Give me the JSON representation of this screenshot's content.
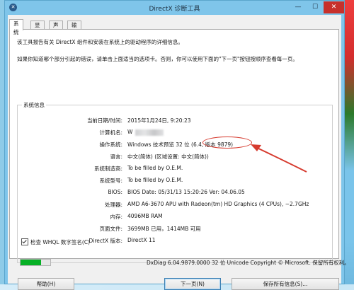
{
  "window": {
    "title": "DirectX 诊断工具",
    "icon_glyph": "✕"
  },
  "tabs": [
    "系统",
    "显示",
    "声音",
    "输入"
  ],
  "intro": {
    "line1": "该工具报告有关 DirectX 组件和安装在系统上的驱动程序的详细信息。",
    "line2": "如果你知道哪个部分引起的错误，请单击上面适当的选项卡。否则，你可以使用下面的\"下一页\"按钮按顺序查看每一页。"
  },
  "system_info": {
    "legend": "系统信息",
    "rows": [
      {
        "label": "当前日期/时间:",
        "value": "2015年1月24日, 9:20:23"
      },
      {
        "label": "计算机名:",
        "value": "W"
      },
      {
        "label": "操作系统:",
        "value": "Windows 技术预览 32 位 (6.4,",
        "highlight": "版本 9879)"
      },
      {
        "label": "语言:",
        "value": "中文(简体) (区域设置: 中文(简体))"
      },
      {
        "label": "系统制造商:",
        "value": "To be filled by O.E.M."
      },
      {
        "label": "系统型号:",
        "value": "To be filled by O.E.M."
      },
      {
        "label": "BIOS:",
        "value": "BIOS Date: 05/31/13 15:20:26 Ver: 04.06.05"
      },
      {
        "label": "处理器:",
        "value": "AMD A6-3670 APU with Radeon(tm) HD Graphics (4 CPUs), ~2.7GHz"
      },
      {
        "label": "内存:",
        "value": "4096MB RAM"
      },
      {
        "label": "页面文件:",
        "value": "3699MB 已用，1414MB 可用"
      },
      {
        "label": "DirectX 版本:",
        "value": "DirectX 11"
      }
    ]
  },
  "whql": {
    "label": "检查 WHQL 数字签名(C)",
    "checked": true
  },
  "progress": {
    "fraction": 0.7
  },
  "footer_note": "DxDiag 6.04.9879.0000 32 位 Unicode  Copyright © Microsoft. 保留所有权利。",
  "buttons": {
    "help": "帮助(H)",
    "next": "下一页(N)",
    "save": "保存所有信息(S)...",
    "minimize": "—",
    "maximize": "☐",
    "close": "✕"
  },
  "colors": {
    "titlebar": "#7fc5ea",
    "close": "#c7302b",
    "highlight": "#d63a2e",
    "progress": "#06b025"
  }
}
